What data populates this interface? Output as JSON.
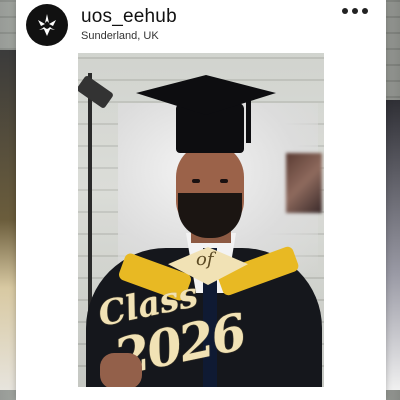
{
  "post": {
    "username": "uos_eehub",
    "location": "Sunderland, UK"
  },
  "icons": {
    "avatar": "university-crest-icon",
    "more": "more-options-icon"
  },
  "prop_sign": {
    "line1": "Class",
    "line2": "2026",
    "word_of": "of"
  },
  "colors": {
    "frame": "#ffffff",
    "gown": "#15171c",
    "hood": "#e8b923",
    "sign": "#f1e2b5"
  }
}
